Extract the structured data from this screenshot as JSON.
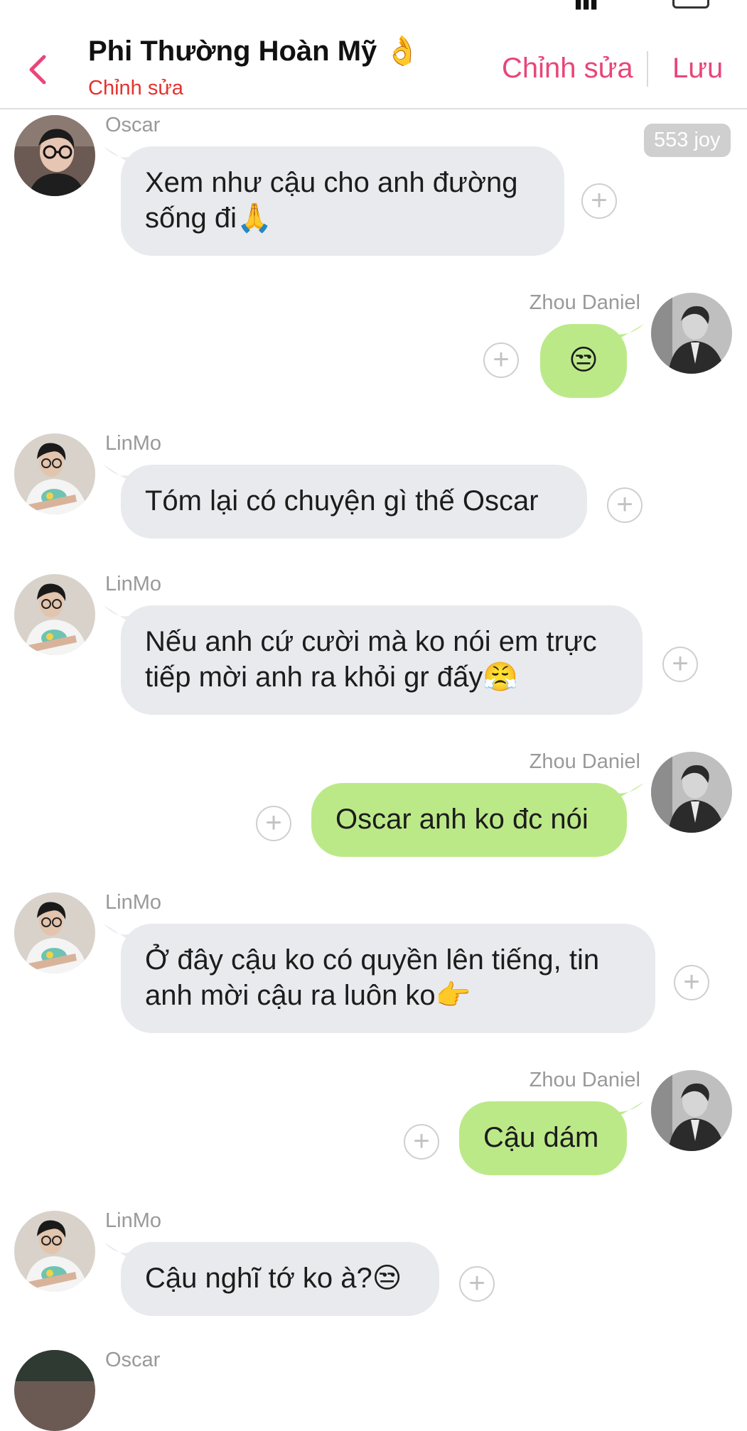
{
  "header": {
    "title": "Phi Thường Hoàn Mỹ 👌",
    "subtitle": "Chỉnh sửa",
    "edit_label": "Chỉnh sửa",
    "save_label": "Lưu"
  },
  "joy_badge": "553 joy",
  "messages": [
    {
      "sender": "Oscar",
      "side": "left",
      "lines": [
        "Xem như cậu cho anh đường",
        "sống đi🙏"
      ]
    },
    {
      "sender": "Zhou Daniel",
      "side": "right",
      "lines": [
        "😒"
      ]
    },
    {
      "sender": "LinMo",
      "side": "left",
      "lines": [
        "Tóm lại có chuyện gì thế  Oscar"
      ]
    },
    {
      "sender": "LinMo",
      "side": "left",
      "lines": [
        "Nếu anh cứ cười mà ko nói em trực",
        "tiếp mời anh ra khỏi gr đấy😤"
      ]
    },
    {
      "sender": "Zhou Daniel",
      "side": "right",
      "lines": [
        "Oscar anh ko đc nói"
      ]
    },
    {
      "sender": "LinMo",
      "side": "left",
      "lines": [
        "Ở đây cậu ko có quyền lên tiếng, tin",
        "anh mời cậu ra luôn ko👉"
      ]
    },
    {
      "sender": "Zhou Daniel",
      "side": "right",
      "lines": [
        "Cậu dám"
      ]
    },
    {
      "sender": "LinMo",
      "side": "left",
      "lines": [
        "Cậu nghĩ tớ ko à?😒"
      ]
    },
    {
      "sender": "Oscar",
      "side": "left",
      "lines": []
    }
  ],
  "colors": {
    "accent": "#e8467a",
    "subtitle": "#e5322d",
    "bubble_left": "#e8eaed",
    "bubble_right": "#bce988",
    "sender_text": "#999999"
  },
  "icons": {
    "back": "chevron-left-icon",
    "reaction": "plus-circle-icon"
  }
}
